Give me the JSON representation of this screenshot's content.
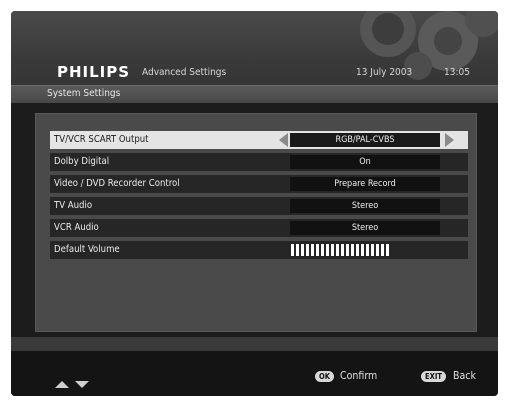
{
  "header": {
    "brand": "PHILIPS",
    "menu_title": "Advanced Settings",
    "date": "13 July 2003",
    "time": "13:05"
  },
  "subheader": {
    "title": "System Settings"
  },
  "settings": [
    {
      "label": "TV/VCR SCART Output",
      "value": "RGB/PAL-CVBS"
    },
    {
      "label": "Dolby Digital",
      "value": "On"
    },
    {
      "label": "Video / DVD Recorder Control",
      "value": "Prepare Record"
    },
    {
      "label": "TV Audio",
      "value": "Stereo"
    },
    {
      "label": "VCR Audio",
      "value": "Stereo"
    },
    {
      "label": "Default Volume",
      "value": ""
    }
  ],
  "footer": {
    "ok_key": "OK",
    "confirm_label": "Confirm",
    "exit_key": "EXIT",
    "back_label": "Back"
  },
  "icons": [
    "gears-decoration",
    "up-arrow-icon",
    "down-arrow-icon",
    "left-arrow-icon",
    "right-arrow-icon"
  ],
  "colors": {
    "screen_bg": "#1c1c1c",
    "panel_bg": "#4a4a4a",
    "selected_row": "#e4e4e4",
    "value_bg": "#111111"
  }
}
